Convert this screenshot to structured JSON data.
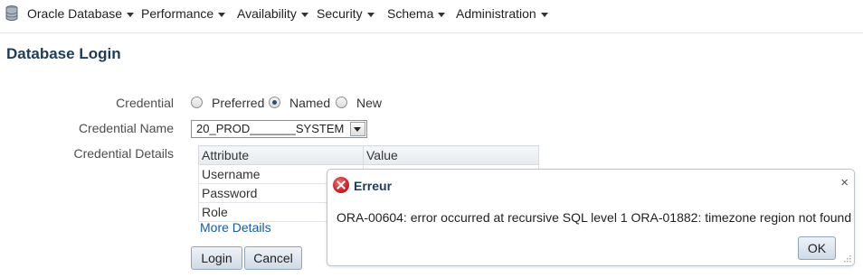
{
  "menubar": {
    "items": [
      {
        "label": "Oracle Database"
      },
      {
        "label": "Performance"
      },
      {
        "label": "Availability"
      },
      {
        "label": "Security"
      },
      {
        "label": "Schema"
      },
      {
        "label": "Administration"
      }
    ]
  },
  "page": {
    "title": "Database Login"
  },
  "form": {
    "credential_label": "Credential",
    "options": [
      {
        "label": "Preferred",
        "checked": false
      },
      {
        "label": "Named",
        "checked": true
      },
      {
        "label": "New",
        "checked": false
      }
    ],
    "credential_name_label": "Credential Name",
    "credential_name_value": "20_PROD_______SYSTEM",
    "credential_details_label": "Credential Details",
    "table": {
      "headers": [
        "Attribute",
        "Value"
      ],
      "rows": [
        [
          "Username",
          ""
        ],
        [
          "Password",
          ""
        ],
        [
          "Role",
          ""
        ]
      ]
    },
    "more_details": "More Details",
    "login_button": "Login",
    "cancel_button": "Cancel"
  },
  "dialog": {
    "title": "Erreur",
    "message": "ORA-00604: error occurred at recursive SQL level 1 ORA-01882: timezone region not found",
    "ok_button": "OK",
    "close_symbol": "×",
    "icon": "error-icon"
  },
  "colors": {
    "title": "#1e3c59",
    "link": "#145c9e",
    "error": "#c9161b"
  }
}
